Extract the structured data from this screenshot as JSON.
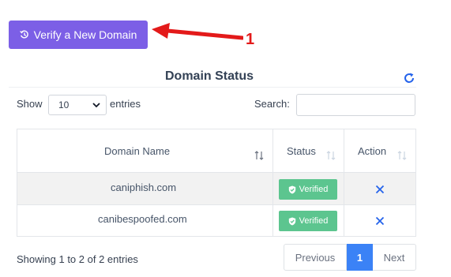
{
  "toolbar": {
    "verify_label": "Verify a New Domain"
  },
  "annotation": {
    "number": "1",
    "color": "#e31a1a"
  },
  "section": {
    "title": "Domain Status"
  },
  "controls": {
    "show_label": "Show",
    "entries_value": "10",
    "entries_label": "entries",
    "search_label": "Search:",
    "search_value": ""
  },
  "table": {
    "columns": [
      "Domain Name",
      "Status",
      "Action"
    ],
    "rows": [
      {
        "domain": "caniphish.com",
        "status": "Verified"
      },
      {
        "domain": "canibespoofed.com",
        "status": "Verified"
      }
    ]
  },
  "footer": {
    "info": "Showing 1 to 2 of 2 entries",
    "prev_label": "Previous",
    "current_page": "1",
    "next_label": "Next"
  },
  "colors": {
    "accent": "#7c5fe6",
    "verified": "#5cc58f",
    "page_active": "#3b82f6",
    "action_icon": "#2563eb"
  },
  "icons": [
    "history-icon",
    "refresh-icon",
    "chevron-down-icon",
    "sort-icon",
    "shield-check-icon",
    "close-icon"
  ]
}
